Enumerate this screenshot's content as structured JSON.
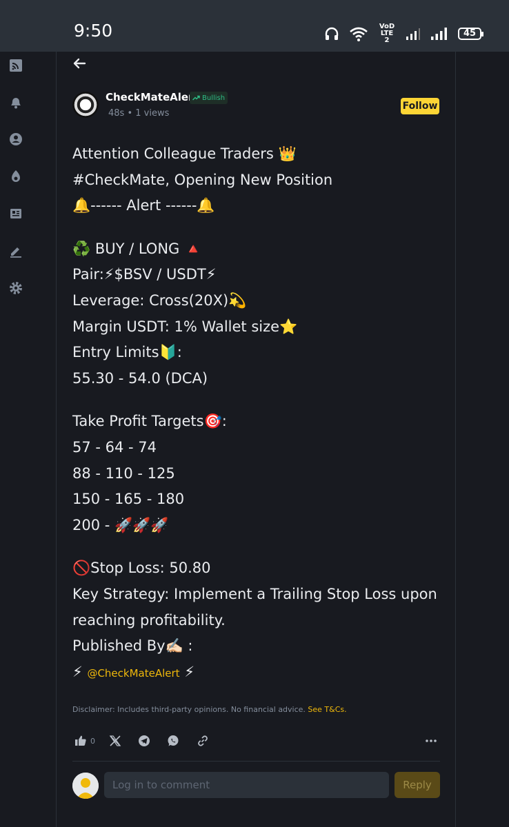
{
  "status_bar": {
    "time": "9:50",
    "network_label": "VoD LTE 2",
    "battery": "45"
  },
  "nav_icons": [
    "feed-icon",
    "bell-icon",
    "profile-icon",
    "fire-icon",
    "news-icon",
    "edit-icon",
    "gear-icon"
  ],
  "post": {
    "author": "CheckMateAlert",
    "sentiment": "Bullish",
    "age": "48s",
    "views": "1 views",
    "follow_label": "Follow",
    "lines": {
      "l1": "Attention Colleague Traders 👑",
      "l2": "#CheckMate, Opening New Position",
      "l3": "🔔------ Alert ------🔔",
      "l4": "♻️ BUY / LONG 🔺",
      "l5": "Pair:⚡$BSV / USDT⚡",
      "l6": "Leverage: Cross(20X)💫",
      "l7": "Margin USDT: 1% Wallet size⭐",
      "l8": "Entry Limits🔰:",
      "l9": "55.30 - 54.0 (DCA)",
      "l10": "Take Profit Targets🎯:",
      "l11": "57 - 64 - 74",
      "l12": "88 - 110 - 125",
      "l13": "150 - 165 - 180",
      "l14": "200 - 🚀🚀🚀",
      "l15": "🚫Stop Loss: 50.80",
      "l16": "Key Strategy: Implement a Trailing Stop Loss upon",
      "l17": "reaching profitability.",
      "l18": "Published By✍🏻 :",
      "l19_pre": "⚡",
      "l19_mention": "@CheckMateAlert",
      "l19_post": "⚡"
    },
    "disclaimer": "Disclaimer: Includes third-party opinions. No financial advice.",
    "disclaimer_link": "See T&Cs.",
    "like_count": "0"
  },
  "comment": {
    "placeholder": "Log in to comment",
    "reply_label": "Reply"
  },
  "colors": {
    "accent": "#fcd535",
    "bullish": "#2ebd85",
    "background": "#181a20"
  }
}
